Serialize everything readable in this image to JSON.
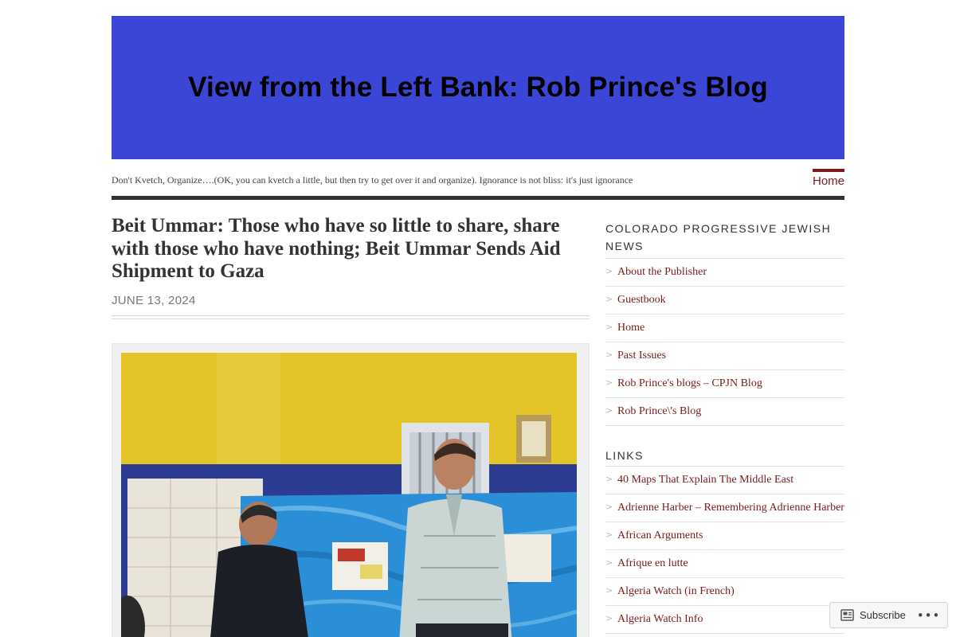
{
  "header": {
    "banner_title": "View from the Left Bank: Rob Prince's Blog",
    "banner_color": "#3b45d6",
    "tagline": "Don't Kvetch, Organize….(OK, you can kvetch a little, but then try to get over it and organize). Ignorance is not bliss: it's just ignorance",
    "nav_home": "Home",
    "accent_color": "#7a1a1a"
  },
  "post": {
    "title": "Beit Ummar: Those who have so little to share, share with those who have nothing; Beit Ummar Sends Aid Shipment to Gaza",
    "date": "JUNE 13, 2024",
    "image_icon": "photo-aid-shipment"
  },
  "sidebar": {
    "widgets": [
      {
        "title": "COLORADO PROGRESSIVE JEWISH NEWS",
        "items": [
          "About the Publisher",
          "Guestbook",
          "Home",
          "Past Issues",
          "Rob Prince's blogs – CPJN Blog",
          "Rob Prince\\'s Blog"
        ]
      },
      {
        "title": "LINKS",
        "items": [
          "40 Maps That Explain The Middle East",
          "Adrienne Harber – Remembering Adrienne Harber",
          "African Arguments",
          "Afrique en lutte",
          "Algeria Watch (in French)",
          "Algeria Watch Info"
        ]
      }
    ],
    "bullet_icon": "chevron-right-icon"
  },
  "subscribe": {
    "label": "Subscribe",
    "more_icon": "more-horizontal-icon"
  }
}
